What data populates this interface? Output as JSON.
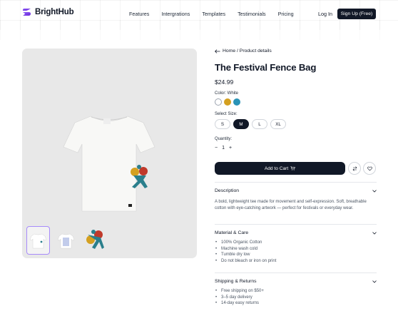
{
  "header": {
    "brand": "BrightHub",
    "nav": [
      "Features",
      "Intergrations",
      "Templates",
      "Testimonials",
      "Pricing"
    ],
    "login": "Log In",
    "signup": "Sign Up (Free)"
  },
  "breadcrumb": "Home / Product details",
  "product": {
    "title": "The Festival Fence Bag",
    "price": "$24.99",
    "color_label": "Color: White",
    "colors": [
      {
        "name": "White",
        "hex": "#ffffff"
      },
      {
        "name": "Mustard",
        "hex": "#d4a020"
      },
      {
        "name": "Teal",
        "hex": "#2a93b6"
      }
    ],
    "size_label": "Select Size:",
    "sizes": [
      "S",
      "M",
      "L",
      "XL"
    ],
    "selected_size": "M",
    "quantity_label": "Quantity:",
    "quantity": "1",
    "minus": "−",
    "plus": "+",
    "add_to_cart": "Add to Cart"
  },
  "sections": {
    "description": {
      "title": "Description",
      "body": "A bold, lightweight tee made for movement and self-expression. Soft, breathable cotton with eye-catching artwork — perfect for festivals or everyday wear."
    },
    "material": {
      "title": "Material & Care",
      "items": [
        "100% Organic Cotton",
        "Machine wash cold",
        "Tumble dry low",
        "Do not bleach or iron on print"
      ]
    },
    "shipping": {
      "title": "Shipping & Returns",
      "items": [
        "Free shipping on $50+",
        "3–5 day delivery",
        "14-day easy returns"
      ]
    }
  },
  "icons": {
    "back": "arrow-left-icon",
    "cart": "cart-icon",
    "compare": "swap-icon",
    "wishlist": "heart-icon",
    "chevron": "chevron-down-icon"
  },
  "accent": "#111827"
}
